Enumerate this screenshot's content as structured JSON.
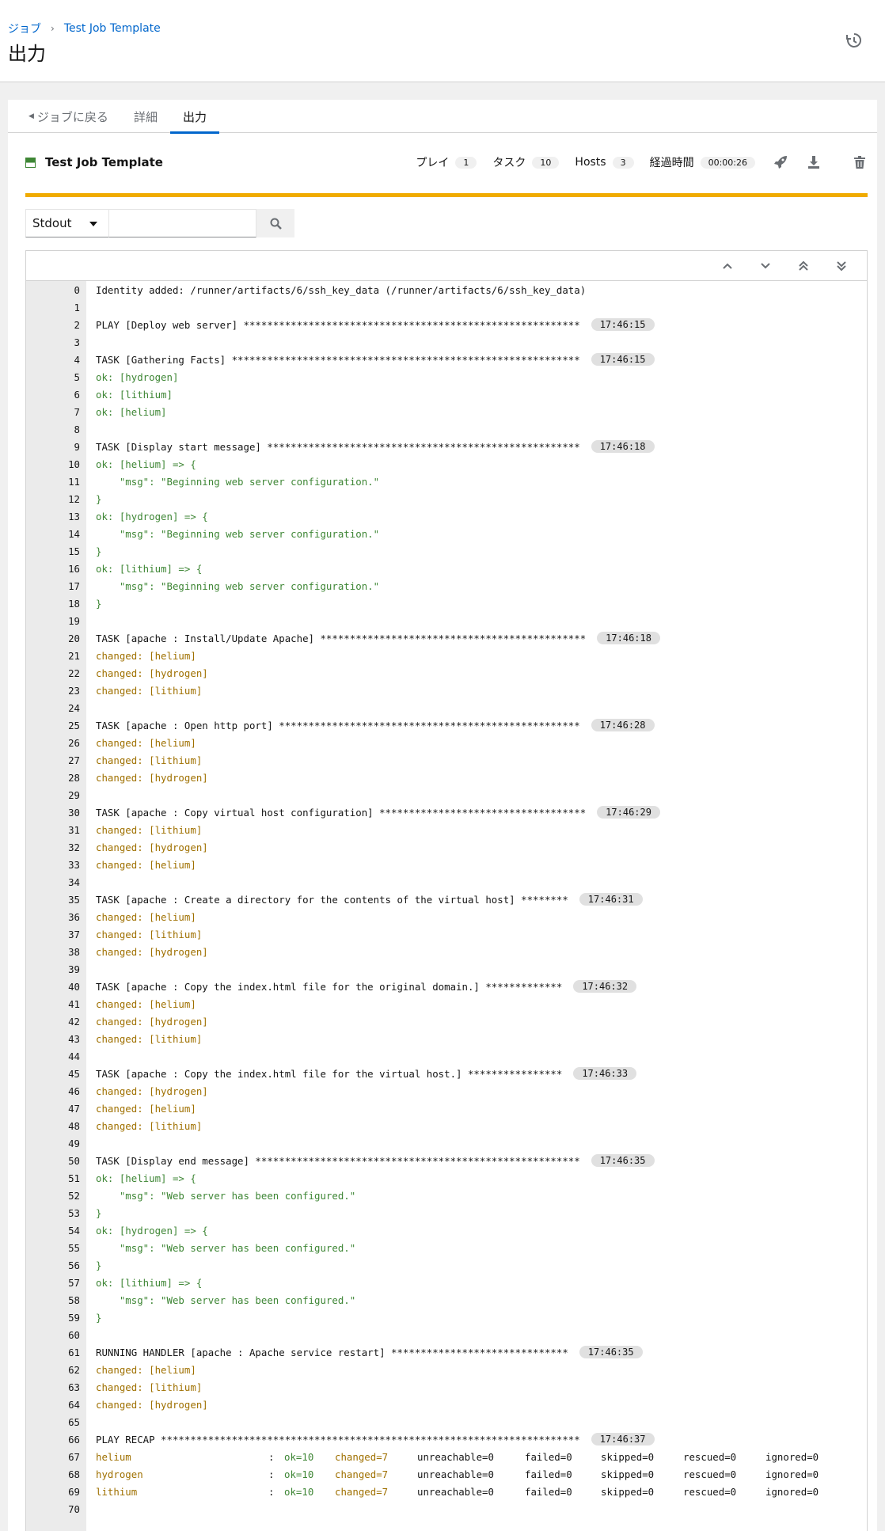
{
  "breadcrumb": {
    "parent": "ジョブ",
    "current": "Test Job Template"
  },
  "page_title": "出力",
  "tabs": {
    "back": "ジョブに戻る",
    "details": "詳細",
    "output": "出力"
  },
  "job": {
    "name": "Test Job Template",
    "status_color": "#3e8635",
    "plays_label": "プレイ",
    "plays": "1",
    "tasks_label": "タスク",
    "tasks": "10",
    "hosts_label": "Hosts",
    "hosts": "3",
    "elapsed_label": "経過時間",
    "elapsed": "00:00:26"
  },
  "search": {
    "select_value": "Stdout",
    "input_value": ""
  },
  "output_lines": [
    {
      "n": "0",
      "t": "Identity added: /runner/artifacts/6/ssh_key_data (/runner/artifacts/6/ssh_key_data)",
      "c": "",
      "ts": ""
    },
    {
      "n": "1",
      "t": "",
      "c": "",
      "ts": ""
    },
    {
      "n": "2",
      "t": "PLAY [Deploy web server] *********************************************************",
      "c": "",
      "ts": "17:46:15"
    },
    {
      "n": "3",
      "t": "",
      "c": "",
      "ts": ""
    },
    {
      "n": "4",
      "t": "TASK [Gathering Facts] ***********************************************************",
      "c": "",
      "ts": "17:46:15"
    },
    {
      "n": "5",
      "t": "ok: [hydrogen]",
      "c": "ok",
      "ts": ""
    },
    {
      "n": "6",
      "t": "ok: [lithium]",
      "c": "ok",
      "ts": ""
    },
    {
      "n": "7",
      "t": "ok: [helium]",
      "c": "ok",
      "ts": ""
    },
    {
      "n": "8",
      "t": "",
      "c": "",
      "ts": ""
    },
    {
      "n": "9",
      "t": "TASK [Display start message] *****************************************************",
      "c": "",
      "ts": "17:46:18"
    },
    {
      "n": "10",
      "t": "ok: [helium] => {",
      "c": "ok",
      "ts": ""
    },
    {
      "n": "11",
      "t": "    \"msg\": \"Beginning web server configuration.\"",
      "c": "ok",
      "ts": ""
    },
    {
      "n": "12",
      "t": "}",
      "c": "ok",
      "ts": ""
    },
    {
      "n": "13",
      "t": "ok: [hydrogen] => {",
      "c": "ok",
      "ts": ""
    },
    {
      "n": "14",
      "t": "    \"msg\": \"Beginning web server configuration.\"",
      "c": "ok",
      "ts": ""
    },
    {
      "n": "15",
      "t": "}",
      "c": "ok",
      "ts": ""
    },
    {
      "n": "16",
      "t": "ok: [lithium] => {",
      "c": "ok",
      "ts": ""
    },
    {
      "n": "17",
      "t": "    \"msg\": \"Beginning web server configuration.\"",
      "c": "ok",
      "ts": ""
    },
    {
      "n": "18",
      "t": "}",
      "c": "ok",
      "ts": ""
    },
    {
      "n": "19",
      "t": "",
      "c": "",
      "ts": ""
    },
    {
      "n": "20",
      "t": "TASK [apache : Install/Update Apache] *********************************************",
      "c": "",
      "ts": "17:46:18"
    },
    {
      "n": "21",
      "t": "changed: [helium]",
      "c": "changed",
      "ts": ""
    },
    {
      "n": "22",
      "t": "changed: [hydrogen]",
      "c": "changed",
      "ts": ""
    },
    {
      "n": "23",
      "t": "changed: [lithium]",
      "c": "changed",
      "ts": ""
    },
    {
      "n": "24",
      "t": "",
      "c": "",
      "ts": ""
    },
    {
      "n": "25",
      "t": "TASK [apache : Open http port] ***************************************************",
      "c": "",
      "ts": "17:46:28"
    },
    {
      "n": "26",
      "t": "changed: [helium]",
      "c": "changed",
      "ts": ""
    },
    {
      "n": "27",
      "t": "changed: [lithium]",
      "c": "changed",
      "ts": ""
    },
    {
      "n": "28",
      "t": "changed: [hydrogen]",
      "c": "changed",
      "ts": ""
    },
    {
      "n": "29",
      "t": "",
      "c": "",
      "ts": ""
    },
    {
      "n": "30",
      "t": "TASK [apache : Copy virtual host configuration] ***********************************",
      "c": "",
      "ts": "17:46:29"
    },
    {
      "n": "31",
      "t": "changed: [lithium]",
      "c": "changed",
      "ts": ""
    },
    {
      "n": "32",
      "t": "changed: [hydrogen]",
      "c": "changed",
      "ts": ""
    },
    {
      "n": "33",
      "t": "changed: [helium]",
      "c": "changed",
      "ts": ""
    },
    {
      "n": "34",
      "t": "",
      "c": "",
      "ts": ""
    },
    {
      "n": "35",
      "t": "TASK [apache : Create a directory for the contents of the virtual host] ********",
      "c": "",
      "ts": "17:46:31"
    },
    {
      "n": "36",
      "t": "changed: [helium]",
      "c": "changed",
      "ts": ""
    },
    {
      "n": "37",
      "t": "changed: [lithium]",
      "c": "changed",
      "ts": ""
    },
    {
      "n": "38",
      "t": "changed: [hydrogen]",
      "c": "changed",
      "ts": ""
    },
    {
      "n": "39",
      "t": "",
      "c": "",
      "ts": ""
    },
    {
      "n": "40",
      "t": "TASK [apache : Copy the index.html file for the original domain.] *************",
      "c": "",
      "ts": "17:46:32"
    },
    {
      "n": "41",
      "t": "changed: [helium]",
      "c": "changed",
      "ts": ""
    },
    {
      "n": "42",
      "t": "changed: [hydrogen]",
      "c": "changed",
      "ts": ""
    },
    {
      "n": "43",
      "t": "changed: [lithium]",
      "c": "changed",
      "ts": ""
    },
    {
      "n": "44",
      "t": "",
      "c": "",
      "ts": ""
    },
    {
      "n": "45",
      "t": "TASK [apache : Copy the index.html file for the virtual host.] ****************",
      "c": "",
      "ts": "17:46:33"
    },
    {
      "n": "46",
      "t": "changed: [hydrogen]",
      "c": "changed",
      "ts": ""
    },
    {
      "n": "47",
      "t": "changed: [helium]",
      "c": "changed",
      "ts": ""
    },
    {
      "n": "48",
      "t": "changed: [lithium]",
      "c": "changed",
      "ts": ""
    },
    {
      "n": "49",
      "t": "",
      "c": "",
      "ts": ""
    },
    {
      "n": "50",
      "t": "TASK [Display end message] *******************************************************",
      "c": "",
      "ts": "17:46:35"
    },
    {
      "n": "51",
      "t": "ok: [helium] => {",
      "c": "ok",
      "ts": ""
    },
    {
      "n": "52",
      "t": "    \"msg\": \"Web server has been configured.\"",
      "c": "ok",
      "ts": ""
    },
    {
      "n": "53",
      "t": "}",
      "c": "ok",
      "ts": ""
    },
    {
      "n": "54",
      "t": "ok: [hydrogen] => {",
      "c": "ok",
      "ts": ""
    },
    {
      "n": "55",
      "t": "    \"msg\": \"Web server has been configured.\"",
      "c": "ok",
      "ts": ""
    },
    {
      "n": "56",
      "t": "}",
      "c": "ok",
      "ts": ""
    },
    {
      "n": "57",
      "t": "ok: [lithium] => {",
      "c": "ok",
      "ts": ""
    },
    {
      "n": "58",
      "t": "    \"msg\": \"Web server has been configured.\"",
      "c": "ok",
      "ts": ""
    },
    {
      "n": "59",
      "t": "}",
      "c": "ok",
      "ts": ""
    },
    {
      "n": "60",
      "t": "",
      "c": "",
      "ts": ""
    },
    {
      "n": "61",
      "t": "RUNNING HANDLER [apache : Apache service restart] ******************************",
      "c": "",
      "ts": "17:46:35"
    },
    {
      "n": "62",
      "t": "changed: [helium]",
      "c": "changed",
      "ts": ""
    },
    {
      "n": "63",
      "t": "changed: [lithium]",
      "c": "changed",
      "ts": ""
    },
    {
      "n": "64",
      "t": "changed: [hydrogen]",
      "c": "changed",
      "ts": ""
    },
    {
      "n": "65",
      "t": "",
      "c": "",
      "ts": ""
    },
    {
      "n": "66",
      "t": "PLAY RECAP ***********************************************************************",
      "c": "",
      "ts": "17:46:37"
    }
  ],
  "recap": [
    {
      "n": "67",
      "host": "helium",
      "ok": "ok=10",
      "changed": "changed=7",
      "unreachable": "unreachable=0",
      "failed": "failed=0",
      "skipped": "skipped=0",
      "rescued": "rescued=0",
      "ignored": "ignored=0"
    },
    {
      "n": "68",
      "host": "hydrogen",
      "ok": "ok=10",
      "changed": "changed=7",
      "unreachable": "unreachable=0",
      "failed": "failed=0",
      "skipped": "skipped=0",
      "rescued": "rescued=0",
      "ignored": "ignored=0"
    },
    {
      "n": "69",
      "host": "lithium",
      "ok": "ok=10",
      "changed": "changed=7",
      "unreachable": "unreachable=0",
      "failed": "failed=0",
      "skipped": "skipped=0",
      "rescued": "rescued=0",
      "ignored": "ignored=0"
    }
  ],
  "last_line": "70",
  "colors": {
    "accent": "#0066cc",
    "ok": "#3e8635",
    "changed": "#9f7000",
    "running": "#f0ab00"
  }
}
